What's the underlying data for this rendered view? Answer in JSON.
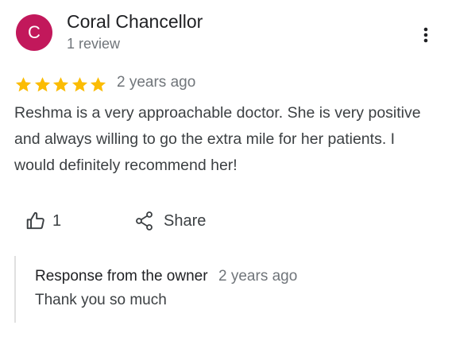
{
  "reviewer": {
    "initial": "C",
    "name": "Coral Chancellor",
    "review_count": "1 review",
    "avatar_color": "#c2185b"
  },
  "menu": {
    "icon": "more-vert-icon"
  },
  "review": {
    "rating": 5,
    "max_rating": 5,
    "star_color": "#fbbc04",
    "date": "2 years ago",
    "text": "Reshma is a very approachable doctor.  She is very positive and always willing to go the extra mile for her patients. I would definitely recommend her!"
  },
  "actions": {
    "like_icon": "thumbs-up-icon",
    "like_count": "1",
    "share_icon": "share-icon",
    "share_label": "Share"
  },
  "owner_response": {
    "title": "Response from the owner",
    "date": "2 years ago",
    "text": "Thank you so much"
  }
}
